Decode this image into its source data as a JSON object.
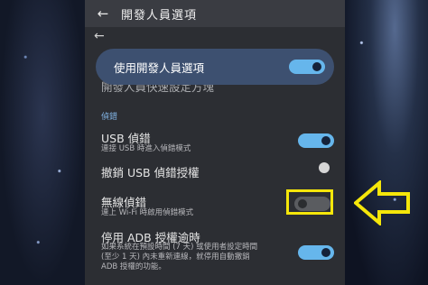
{
  "app": {
    "title": "開發人員選項"
  },
  "icons": {
    "back": "arrow-left-icon",
    "annotation": "yellow-arrow-icon"
  },
  "master_switch": {
    "label": "使用開發人員選項",
    "enabled": true
  },
  "quick_settings": {
    "label": "開發人員快速設定方塊"
  },
  "section": {
    "label": "偵錯"
  },
  "items": [
    {
      "title": "USB 偵錯",
      "subtitle": "連接 USB 時進入偵錯模式",
      "enabled": true
    },
    {
      "title": "撤銷 USB 偵錯授權"
    },
    {
      "title": "無線偵錯",
      "subtitle": "連上 Wi-Fi 時啟用偵錯模式",
      "enabled": false
    },
    {
      "title": "停用 ADB 授權逾時",
      "subtitle_lines": [
        "如果系統在預設時間 (7 天) 或使用者設定時間",
        "(至少 1 天) 內未重新連線，就停用自動撤銷",
        "ADB 授權的功能。"
      ],
      "enabled": true
    }
  ],
  "colors": {
    "toggle_on": "#66b6ec",
    "highlight": "#f5e60a",
    "master_bg": "#3d5070"
  }
}
